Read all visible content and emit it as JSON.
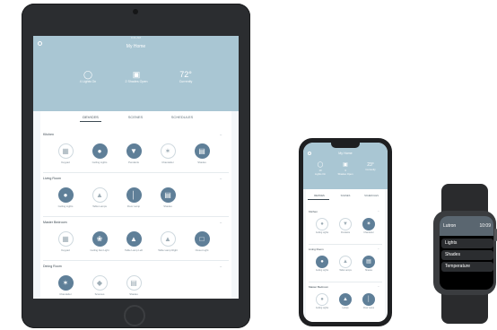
{
  "colors": {
    "hero": "#a9c6d3",
    "device_on": "#5f7f98",
    "text_dark": "#3d4a53"
  },
  "ipad": {
    "status_bar": "9:41 AM",
    "title": "My Home",
    "stats": [
      {
        "icon": "bulb-icon",
        "label": "4 Lights On"
      },
      {
        "icon": "shade-icon",
        "label": "2 Shades Open"
      },
      {
        "icon": "thermostat-icon",
        "value": "72°",
        "label": "Currently"
      }
    ],
    "tabs": [
      "DEVICES",
      "SCENES",
      "SCHEDULES"
    ],
    "rooms": [
      {
        "name": "Kitchen",
        "devices": [
          {
            "label": "Keypad",
            "icon": "keypad-icon",
            "on": false
          },
          {
            "label": "Ceiling Lights",
            "icon": "ceiling-light-icon",
            "on": true
          },
          {
            "label": "Pendants",
            "icon": "pendant-icon",
            "on": true
          },
          {
            "label": "Chandelier",
            "icon": "chandelier-icon",
            "on": false
          },
          {
            "label": "Shades",
            "icon": "shade-icon",
            "on": true
          }
        ]
      },
      {
        "name": "Living Room",
        "devices": [
          {
            "label": "Ceiling Lights",
            "icon": "ceiling-light-icon",
            "on": true
          },
          {
            "label": "Table Lamps",
            "icon": "table-lamp-icon",
            "on": false
          },
          {
            "label": "Floor Lamp",
            "icon": "floor-lamp-icon",
            "on": true
          },
          {
            "label": "Shades",
            "icon": "shade-icon",
            "on": true
          }
        ]
      },
      {
        "name": "Master Bedroom",
        "devices": [
          {
            "label": "Keypad",
            "icon": "keypad-icon",
            "on": false
          },
          {
            "label": "Ceiling Fan Light",
            "icon": "fan-light-icon",
            "on": true
          },
          {
            "label": "Table Lamp Left",
            "icon": "table-lamp-icon",
            "on": true
          },
          {
            "label": "Table Lamp Right",
            "icon": "table-lamp-icon",
            "on": false
          },
          {
            "label": "Closet Light",
            "icon": "closet-light-icon",
            "on": true
          }
        ]
      },
      {
        "name": "Dining Room",
        "devices": [
          {
            "label": "Chandelier",
            "icon": "chandelier-icon",
            "on": true
          },
          {
            "label": "Sconces",
            "icon": "sconce-icon",
            "on": false
          },
          {
            "label": "Shades",
            "icon": "shade-icon",
            "on": false
          }
        ]
      }
    ]
  },
  "iphone": {
    "title": "My Home",
    "stats": [
      {
        "icon": "bulb-icon",
        "value": "10",
        "label": "Lights On"
      },
      {
        "icon": "shade-icon",
        "value": "3",
        "label": "Shades Open"
      },
      {
        "icon": "thermostat-icon",
        "value": "23°",
        "label": "Currently"
      }
    ],
    "tabs": [
      "DEVICES",
      "SCENES",
      "SCHEDULES"
    ],
    "rooms": [
      {
        "name": "Kitchen",
        "devices": [
          {
            "label": "Ceiling Lights",
            "icon": "ceiling-light-icon",
            "on": false
          },
          {
            "label": "Pendants",
            "icon": "pendant-icon",
            "on": false
          },
          {
            "label": "Chandelier",
            "icon": "chandelier-icon",
            "on": true
          }
        ]
      },
      {
        "name": "Living Room",
        "devices": [
          {
            "label": "Ceiling Lights",
            "icon": "ceiling-light-icon",
            "on": true
          },
          {
            "label": "Table Lamps",
            "icon": "table-lamp-icon",
            "on": false
          },
          {
            "label": "Shades",
            "icon": "shade-icon",
            "on": true
          }
        ]
      },
      {
        "name": "Master Bedroom",
        "devices": [
          {
            "label": "Ceiling Lights",
            "icon": "ceiling-light-icon",
            "on": false
          },
          {
            "label": "Lamps",
            "icon": "table-lamp-icon",
            "on": true
          },
          {
            "label": "Floor Lamp",
            "icon": "floor-lamp-icon",
            "on": true
          }
        ]
      }
    ]
  },
  "watch": {
    "app_name": "Lutron",
    "time": "10:09",
    "menu": [
      "Lights",
      "Shades",
      "Temperature"
    ]
  }
}
